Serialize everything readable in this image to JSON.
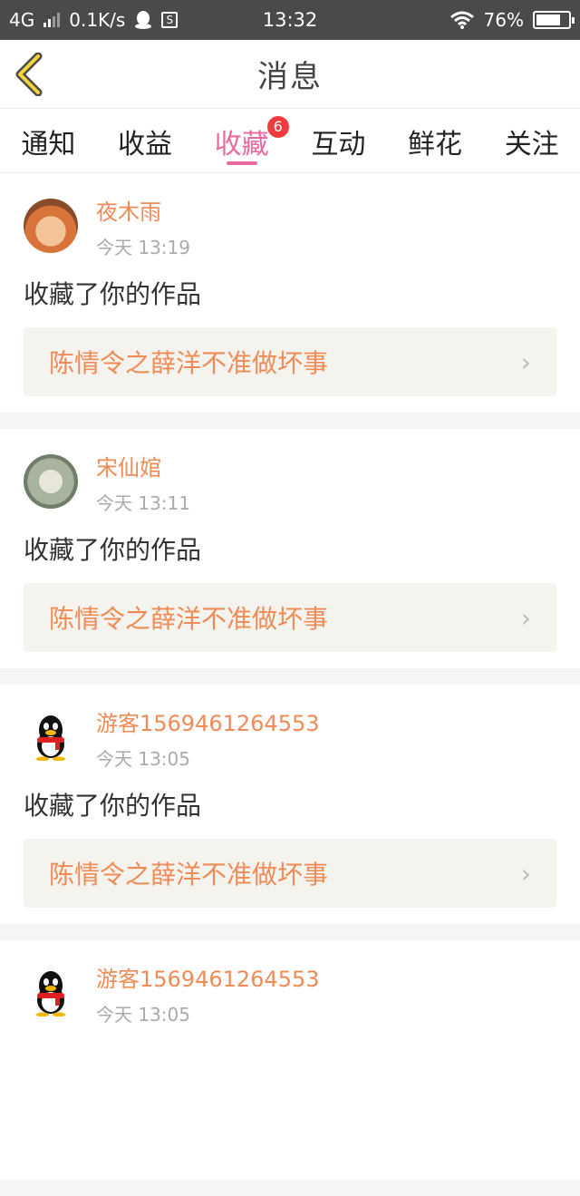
{
  "status_bar": {
    "network": "4G",
    "speed": "0.1K/s",
    "app_icon_letter": "S",
    "time": "13:32",
    "battery": "76%",
    "battery_level": 0.76
  },
  "header": {
    "title": "消息"
  },
  "tabs": [
    {
      "label": "通知"
    },
    {
      "label": "收益"
    },
    {
      "label": "收藏",
      "badge": "6"
    },
    {
      "label": "互动"
    },
    {
      "label": "鲜花"
    },
    {
      "label": "关注"
    }
  ],
  "messages": [
    {
      "user": "夜木雨",
      "time": "今天 13:19",
      "text": "收藏了你的作品",
      "work_title": "陈情令之薛洋不准做坏事"
    },
    {
      "user": "宋仙婠",
      "time": "今天 13:11",
      "text": "收藏了你的作品",
      "work_title": "陈情令之薛洋不准做坏事"
    },
    {
      "user": "游客1569461264553",
      "time": "今天 13:05",
      "text": "收藏了你的作品",
      "work_title": "陈情令之薛洋不准做坏事"
    },
    {
      "user": "游客1569461264553",
      "time": "今天 13:05"
    }
  ],
  "colors": {
    "accent_pink": "#e96aa1",
    "accent_orange": "#ef8b57",
    "badge_red": "#f03c3c"
  }
}
